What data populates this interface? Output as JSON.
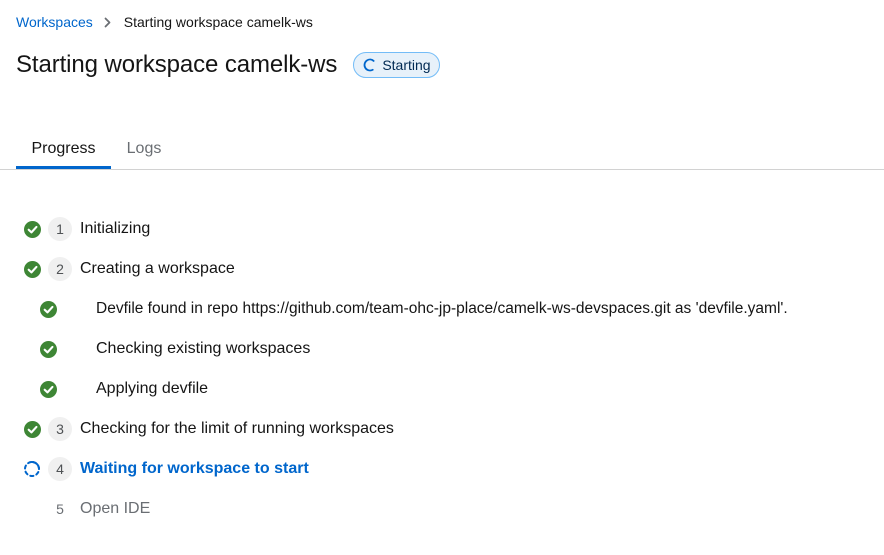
{
  "breadcrumb": {
    "link": "Workspaces",
    "current": "Starting workspace camelk-ws"
  },
  "page": {
    "title": "Starting workspace camelk-ws",
    "status": "Starting"
  },
  "tabs": [
    {
      "label": "Progress",
      "active": true
    },
    {
      "label": "Logs",
      "active": false
    }
  ],
  "steps": [
    {
      "number": "1",
      "label": "Initializing",
      "state": "done"
    },
    {
      "number": "2",
      "label": "Creating a workspace",
      "state": "done",
      "substeps": [
        {
          "label": "Devfile found in repo https://github.com/team-ohc-jp-place/camelk-ws-devspaces.git as 'devfile.yaml'.",
          "state": "done"
        },
        {
          "label": "Checking existing workspaces",
          "state": "done"
        },
        {
          "label": "Applying devfile",
          "state": "done"
        }
      ]
    },
    {
      "number": "3",
      "label": "Checking for the limit of running workspaces",
      "state": "done"
    },
    {
      "number": "4",
      "label": "Waiting for workspace to start",
      "state": "in-progress"
    },
    {
      "number": "5",
      "label": "Open IDE",
      "state": "pending"
    }
  ],
  "colors": {
    "link": "#0066cc",
    "success": "#3e8635",
    "badge_bg": "#e7f1fa",
    "badge_border": "#73bcf7"
  },
  "icons": {
    "done": "check-circle-icon",
    "in_progress": "spinner-icon",
    "breadcrumb_separator": "chevron-right-icon"
  }
}
